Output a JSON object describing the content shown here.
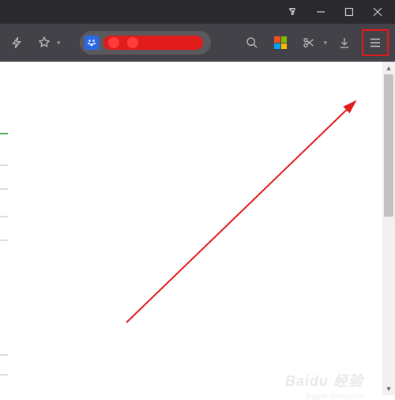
{
  "titlebar": {
    "icons": {
      "appearance": "appearance-icon",
      "minimize": "minimize-icon",
      "maximize": "maximize-icon",
      "close": "close-icon"
    }
  },
  "toolbar": {
    "icons": {
      "flash": "flash-icon",
      "favorite": "star-icon",
      "search": "search-icon",
      "mslogo": "microsoft-logo",
      "screenshot": "scissors-icon",
      "download": "download-icon",
      "menu": "hamburger-menu-icon"
    },
    "favicon": "baidu-paw-icon",
    "address_redacted": true
  },
  "annotation": {
    "type": "arrow",
    "color": "#e21b1b",
    "target": "hamburger-menu-icon"
  },
  "watermark": {
    "brand": "Baidu 经验",
    "url": "jingyan.baidu.com"
  },
  "scrollbar": {
    "present": true
  }
}
